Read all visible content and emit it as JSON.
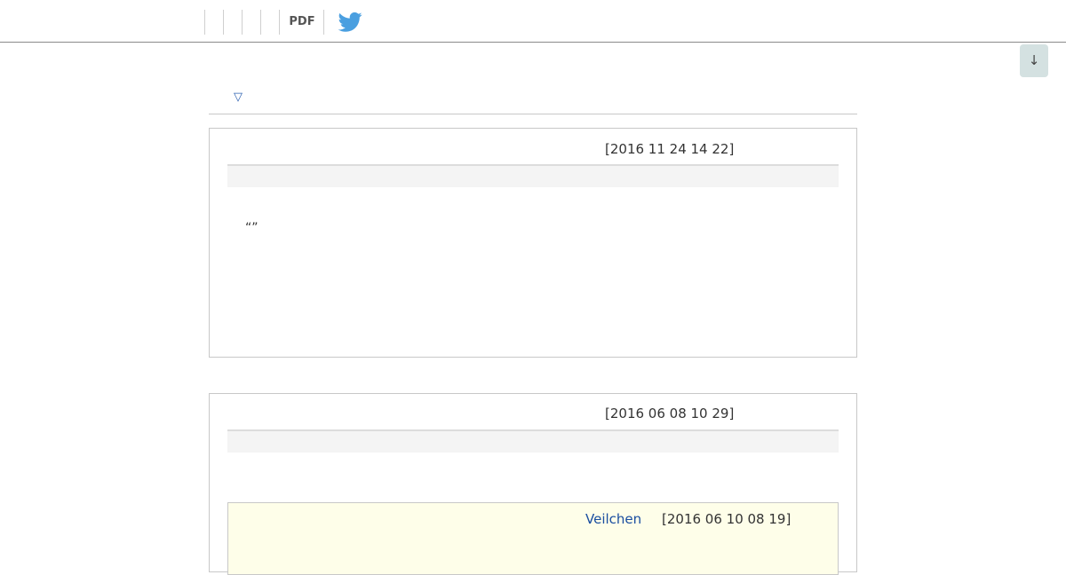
{
  "header": {
    "pdf_label": "PDF",
    "share_icon": "twitter-bird-icon",
    "twitter_color": "#4a9fe0"
  },
  "scroll": {
    "down_label": "↓"
  },
  "list_toggle": {
    "symbol": "▽"
  },
  "posts": [
    {
      "date": "[2016 11 24 14 22]",
      "quote": "“”"
    },
    {
      "date": "[2016 06 08 10 29]",
      "reply": {
        "author": "Veilchen",
        "date": "[2016 06 10 08 19]"
      }
    }
  ]
}
